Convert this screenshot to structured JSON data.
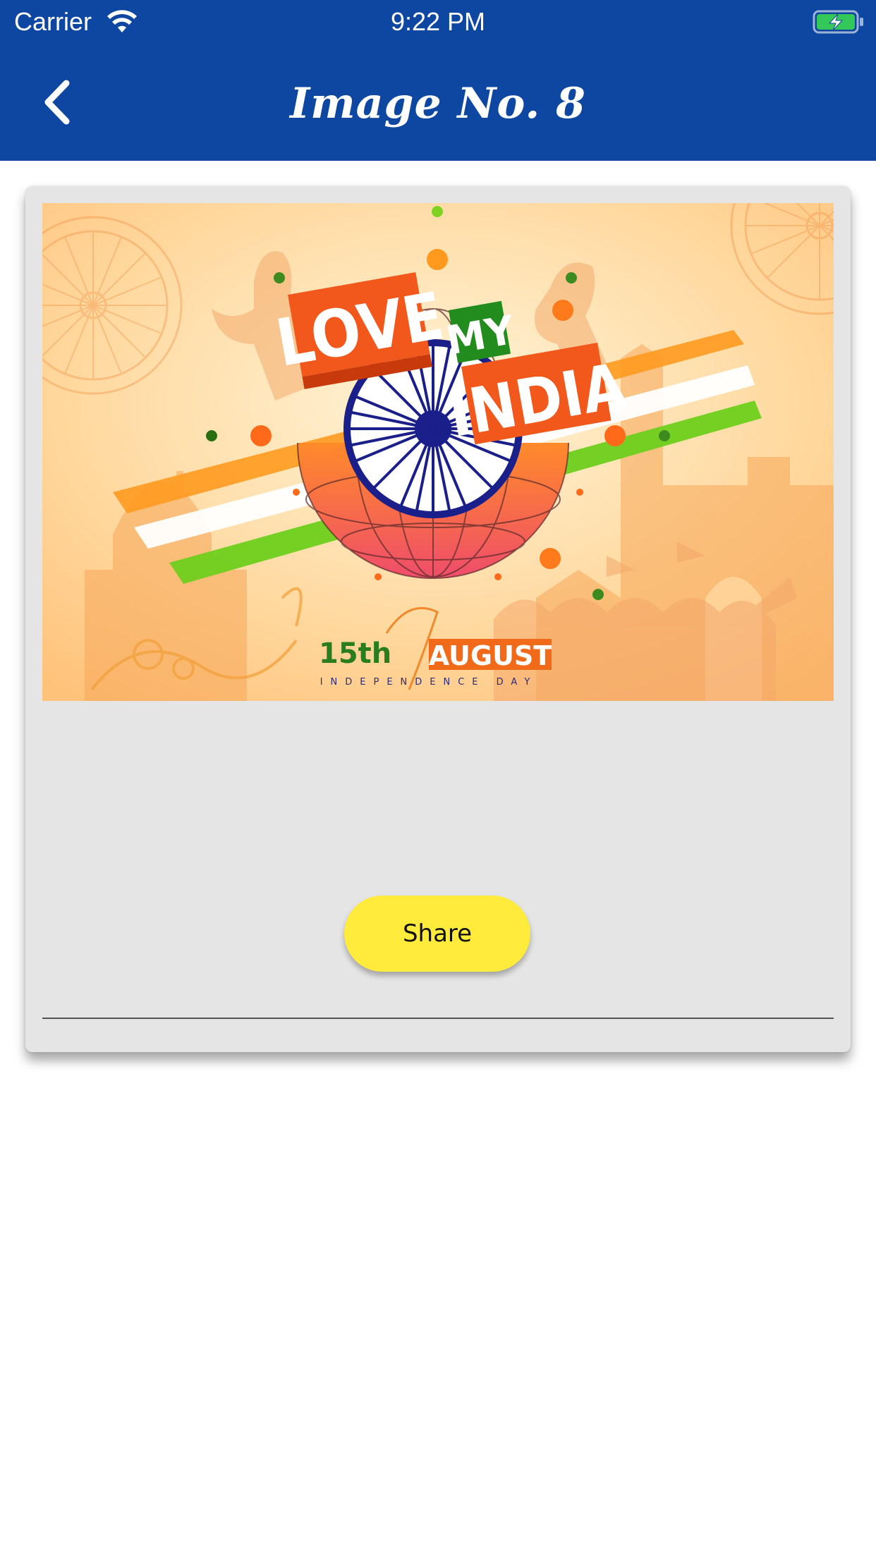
{
  "status_bar": {
    "carrier": "Carrier",
    "time": "9:22 PM",
    "wifi_icon": "wifi-icon",
    "battery_icon": "battery-charging-icon",
    "battery_color": "#34c759"
  },
  "nav": {
    "title": "Image No. 8",
    "back_icon": "chevron-left-icon",
    "background": "#0e47a1"
  },
  "image": {
    "headline_love": "LOVE",
    "headline_my": "MY",
    "headline_india": "INDIA",
    "date_day": "15th",
    "date_month": "AUGUST",
    "subtitle": "INDEPENDENCE DAY"
  },
  "actions": {
    "share_label": "Share",
    "share_color": "#ffeb3b"
  }
}
